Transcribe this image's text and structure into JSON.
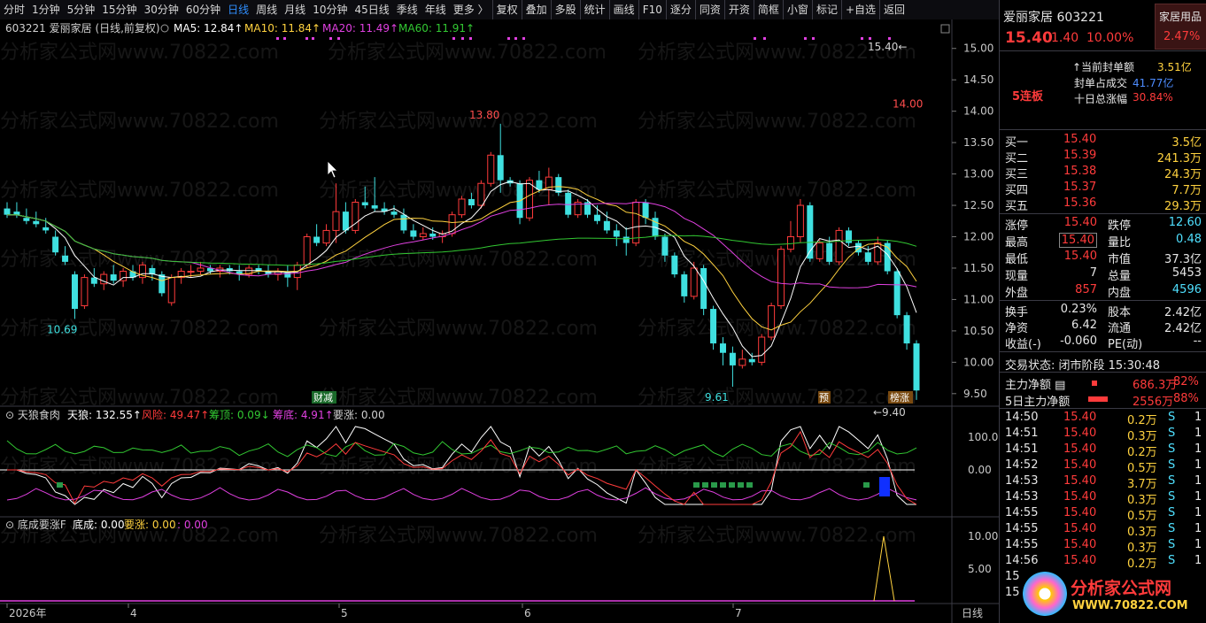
{
  "toolbar": {
    "periods": [
      "分时",
      "1分钟",
      "5分钟",
      "15分钟",
      "30分钟",
      "60分钟",
      "日线",
      "周线",
      "月线",
      "10分钟",
      "45日线",
      "季线",
      "年线",
      "更多 〉"
    ],
    "active": "日线",
    "tools": [
      "复权",
      "叠加",
      "多股",
      "统计",
      "画线",
      "F10",
      "逐分",
      "同资",
      "开资",
      "简框",
      "小窗",
      "标记",
      "+自选",
      "返回"
    ]
  },
  "main_legend": {
    "code_name": "603221 爱丽家居 (日线,前复权)",
    "ma5": "MA5: 12.84↑",
    "ma10": "MA10: 11.84↑",
    "ma20": "MA20: 11.49↑",
    "ma60": "MA60: 11.91↑"
  },
  "price_axis": [
    "15.00",
    "14.50",
    "14.00",
    "13.50",
    "13.00",
    "12.50",
    "12.00",
    "11.50",
    "11.00",
    "10.50",
    "10.00",
    "9.50"
  ],
  "annotations": {
    "high_label": "13.80",
    "low_label_1": "10.69",
    "low_label_2": "9.61",
    "last_low": "9.40",
    "top_right": "15.40",
    "limit_label": "14.00",
    "tag_caijian": "财减",
    "tag_yu": "预",
    "tag_bangzhang": "榜涨"
  },
  "ind1_legend": {
    "name": "天狼食肉",
    "tianlang": "天狼: 132.55↑",
    "fengxian": "风险: 49.47↑",
    "choudding": "筹顶: 0.09↓",
    "choudi": "筹底: 4.91↑",
    "yaozhang": "要涨: 0.00"
  },
  "ind1_axis": [
    "100.0",
    "0.00"
  ],
  "ind2_legend": {
    "name": "底成要涨F",
    "dicheng": "底成: 0.00",
    "yaozhang": "要涨: 0.00",
    "extra": ": 0.00"
  },
  "ind2_axis": [
    "10.00",
    "5.00"
  ],
  "date_axis": [
    "2026年",
    "4",
    "5",
    "6",
    "7"
  ],
  "period_corner": "日线",
  "chart_data": {
    "type": "candlestick",
    "ma_colors": {
      "ma5": "#ffffff",
      "ma10": "#ffd23f",
      "ma20": "#e040e0",
      "ma60": "#32c832"
    },
    "ohlc": [
      [
        12.45,
        12.55,
        12.3,
        12.35
      ],
      [
        12.4,
        12.55,
        12.3,
        12.35
      ],
      [
        12.3,
        12.45,
        12.2,
        12.25
      ],
      [
        12.25,
        12.4,
        12.15,
        12.2
      ],
      [
        12.15,
        12.3,
        12.05,
        12.1
      ],
      [
        12.0,
        12.1,
        11.7,
        11.75
      ],
      [
        11.7,
        11.85,
        11.55,
        11.6
      ],
      [
        11.4,
        11.45,
        10.69,
        10.85
      ],
      [
        10.9,
        11.4,
        10.85,
        11.35
      ],
      [
        11.35,
        11.5,
        11.2,
        11.25
      ],
      [
        11.25,
        11.45,
        11.15,
        11.4
      ],
      [
        11.4,
        11.55,
        11.25,
        11.3
      ],
      [
        11.3,
        11.5,
        11.2,
        11.45
      ],
      [
        11.45,
        11.55,
        11.3,
        11.35
      ],
      [
        11.35,
        11.6,
        11.25,
        11.55
      ],
      [
        11.5,
        11.55,
        11.3,
        11.4
      ],
      [
        11.4,
        11.45,
        11.05,
        11.1
      ],
      [
        10.95,
        11.4,
        10.9,
        11.35
      ],
      [
        11.35,
        11.5,
        11.25,
        11.45
      ],
      [
        11.45,
        11.55,
        11.35,
        11.45
      ],
      [
        11.45,
        11.6,
        11.4,
        11.5
      ],
      [
        11.5,
        11.55,
        11.4,
        11.45
      ],
      [
        11.45,
        11.55,
        11.35,
        11.5
      ],
      [
        11.5,
        11.55,
        11.4,
        11.45
      ],
      [
        11.45,
        11.55,
        11.3,
        11.4
      ],
      [
        11.4,
        11.55,
        11.35,
        11.5
      ],
      [
        11.5,
        11.55,
        11.4,
        11.45
      ],
      [
        11.45,
        11.55,
        11.35,
        11.4
      ],
      [
        11.4,
        11.5,
        11.3,
        11.45
      ],
      [
        11.45,
        11.55,
        11.2,
        11.35
      ],
      [
        11.35,
        11.6,
        11.15,
        11.55
      ],
      [
        11.55,
        12.05,
        11.5,
        12.0
      ],
      [
        12.0,
        12.2,
        11.85,
        11.9
      ],
      [
        11.9,
        12.2,
        11.85,
        12.1
      ],
      [
        12.1,
        12.85,
        11.9,
        12.4
      ],
      [
        12.4,
        12.55,
        12.05,
        12.1
      ],
      [
        12.1,
        12.6,
        12.05,
        12.55
      ],
      [
        12.55,
        12.8,
        12.45,
        12.5
      ],
      [
        12.5,
        12.95,
        12.4,
        12.45
      ],
      [
        12.45,
        12.55,
        12.35,
        12.4
      ],
      [
        12.4,
        12.5,
        12.3,
        12.35
      ],
      [
        12.35,
        12.45,
        12.05,
        12.1
      ],
      [
        12.1,
        12.2,
        11.95,
        12.0
      ],
      [
        12.0,
        12.15,
        11.95,
        12.05
      ],
      [
        12.05,
        12.15,
        11.95,
        12.0
      ],
      [
        12.0,
        12.1,
        11.9,
        12.05
      ],
      [
        12.05,
        12.4,
        12.0,
        12.35
      ],
      [
        12.35,
        12.65,
        12.3,
        12.6
      ],
      [
        12.6,
        12.7,
        12.45,
        12.5
      ],
      [
        12.5,
        12.9,
        12.45,
        12.85
      ],
      [
        12.85,
        13.35,
        12.8,
        13.3
      ],
      [
        13.3,
        13.8,
        12.7,
        12.9
      ],
      [
        12.9,
        12.95,
        12.8,
        12.85
      ],
      [
        12.85,
        12.9,
        12.2,
        12.3
      ],
      [
        12.3,
        12.95,
        12.25,
        12.9
      ],
      [
        12.9,
        13.05,
        12.7,
        12.75
      ],
      [
        12.75,
        13.1,
        12.5,
        12.95
      ],
      [
        12.95,
        13.0,
        12.65,
        12.7
      ],
      [
        12.7,
        12.75,
        12.3,
        12.35
      ],
      [
        12.35,
        12.6,
        12.3,
        12.55
      ],
      [
        12.55,
        12.6,
        12.3,
        12.35
      ],
      [
        12.35,
        12.5,
        12.2,
        12.25
      ],
      [
        12.25,
        12.4,
        12.05,
        12.1
      ],
      [
        12.1,
        12.2,
        11.85,
        12.0
      ],
      [
        12.0,
        12.15,
        11.7,
        11.9
      ],
      [
        11.9,
        12.6,
        11.85,
        12.55
      ],
      [
        12.55,
        12.6,
        12.2,
        12.3
      ],
      [
        12.3,
        12.4,
        11.95,
        12.0
      ],
      [
        12.0,
        12.05,
        11.6,
        11.7
      ],
      [
        11.7,
        11.75,
        11.35,
        11.4
      ],
      [
        11.4,
        11.45,
        10.95,
        11.05
      ],
      [
        11.05,
        11.6,
        11.0,
        11.5
      ],
      [
        11.5,
        11.55,
        10.75,
        10.85
      ],
      [
        10.85,
        10.9,
        10.2,
        10.3
      ],
      [
        10.3,
        10.4,
        9.95,
        10.15
      ],
      [
        10.15,
        10.25,
        9.61,
        9.95
      ],
      [
        9.95,
        10.2,
        9.9,
        10.05
      ],
      [
        10.05,
        10.15,
        9.95,
        10.0
      ],
      [
        10.0,
        10.45,
        9.95,
        10.4
      ],
      [
        10.4,
        10.95,
        10.35,
        10.9
      ],
      [
        10.9,
        11.85,
        10.85,
        11.8
      ],
      [
        11.8,
        12.25,
        11.75,
        12.0
      ],
      [
        12.0,
        12.6,
        11.9,
        12.5
      ],
      [
        12.5,
        12.55,
        11.6,
        11.65
      ],
      [
        11.65,
        11.95,
        11.6,
        11.9
      ],
      [
        11.9,
        12.0,
        11.55,
        11.6
      ],
      [
        11.6,
        12.15,
        11.55,
        12.1
      ],
      [
        12.1,
        12.15,
        11.85,
        11.9
      ],
      [
        11.9,
        11.95,
        11.7,
        11.75
      ],
      [
        11.75,
        11.85,
        11.55,
        11.6
      ],
      [
        11.6,
        12.0,
        11.55,
        11.9
      ],
      [
        11.9,
        11.95,
        11.4,
        11.45
      ],
      [
        11.45,
        11.5,
        10.7,
        10.75
      ],
      [
        10.75,
        10.8,
        10.2,
        10.3
      ],
      [
        10.3,
        10.35,
        9.4,
        9.55
      ]
    ]
  },
  "quote": {
    "name": "爱丽家居",
    "code": "603221",
    "price": "15.40",
    "change": "1.40",
    "pct": "10.00%",
    "sector": "家居用品",
    "sector_pct": "2.47%",
    "streak": "5连板",
    "fd_label": "当前封单额",
    "fd_value": "3.51亿",
    "zb_label": "封单占成交",
    "zb_value": "41.77亿",
    "zf_label": "十日总涨幅",
    "zf_value": "30.84%",
    "bids": [
      {
        "label": "买一",
        "price": "15.40",
        "vol": "3.5亿"
      },
      {
        "label": "买二",
        "price": "15.39",
        "vol": "241.3万"
      },
      {
        "label": "买三",
        "price": "15.38",
        "vol": "24.3万"
      },
      {
        "label": "买四",
        "price": "15.37",
        "vol": "7.7万"
      },
      {
        "label": "买五",
        "price": "15.36",
        "vol": "29.3万"
      }
    ],
    "stats": [
      {
        "l1": "涨停",
        "v1": "15.40",
        "c1": "red",
        "l2": "跌停",
        "v2": "12.60",
        "c2": "cyan"
      },
      {
        "l1": "最高",
        "v1": "15.40",
        "c1": "red",
        "l2": "量比",
        "v2": "0.48",
        "c2": "cyan"
      },
      {
        "l1": "最低",
        "v1": "15.40",
        "c1": "red",
        "l2": "市值",
        "v2": "37.3亿",
        "c2": "wht"
      },
      {
        "l1": "现量",
        "v1": "7",
        "c1": "wht",
        "l2": "总量",
        "v2": "5453",
        "c2": "wht"
      },
      {
        "l1": "外盘",
        "v1": "857",
        "c1": "red",
        "l2": "内盘",
        "v2": "4596",
        "c2": "cyan"
      }
    ],
    "fin": [
      {
        "l1": "换手",
        "v1": "0.23%",
        "l2": "股本",
        "v2": "2.42亿"
      },
      {
        "l1": "净资",
        "v1": "6.42",
        "l2": "流通",
        "v2": "2.42亿"
      },
      {
        "l1": "收益(-)",
        "v1": "-0.060",
        "l2": "PE(动)",
        "v2": "--"
      }
    ],
    "status_label": "交易状态:",
    "status": "闭市阶段 15:30:48",
    "main_net_label": "主力净额",
    "main_net": "686.3万",
    "main_net_pct": "82%",
    "five_net_label": "5日主力净额",
    "five_net": "2556万",
    "five_net_pct": "88%",
    "ticks": [
      [
        "14:50",
        "15.40",
        "0.2万",
        "S",
        "1"
      ],
      [
        "14:51",
        "15.40",
        "0.3万",
        "S",
        "1"
      ],
      [
        "14:51",
        "15.40",
        "0.2万",
        "S",
        "1"
      ],
      [
        "14:52",
        "15.40",
        "0.5万",
        "S",
        "1"
      ],
      [
        "14:53",
        "15.40",
        "3.7万",
        "S",
        "1"
      ],
      [
        "14:53",
        "15.40",
        "0.3万",
        "S",
        "1"
      ],
      [
        "14:55",
        "15.40",
        "0.5万",
        "S",
        "1"
      ],
      [
        "14:55",
        "15.40",
        "0.3万",
        "S",
        "1"
      ],
      [
        "14:55",
        "15.40",
        "0.3万",
        "S",
        "1"
      ],
      [
        "14:56",
        "15.40",
        "0.2万",
        "S",
        "1"
      ],
      [
        "15:",
        "",
        "",
        "",
        ""
      ],
      [
        "15:",
        "",
        "",
        "",
        ""
      ]
    ]
  },
  "logo": {
    "name": "分析家公式网",
    "url": "WWW.70822.COM"
  },
  "watermark": "分析家公式网www.70822.com"
}
